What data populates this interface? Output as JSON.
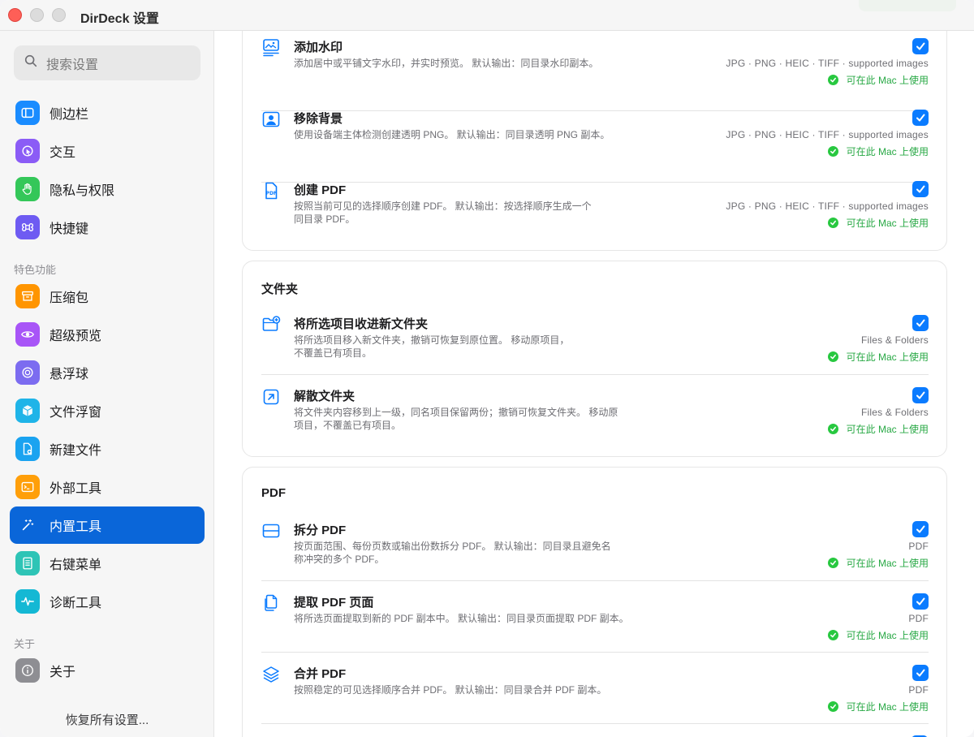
{
  "window": {
    "title": "DirDeck 设置"
  },
  "sidebar": {
    "search_placeholder": "搜索设置",
    "general_items": [
      {
        "label": "侧边栏",
        "icon": "sidebar-icon",
        "color": "#1a8cff"
      },
      {
        "label": "交互",
        "icon": "pointer-icon",
        "color": "#8b5cf6"
      },
      {
        "label": "隐私与权限",
        "icon": "hand-icon",
        "color": "#34c759"
      },
      {
        "label": "快捷键",
        "icon": "command-icon",
        "color": "#6e5bf2"
      }
    ],
    "features_header": "特色功能",
    "feature_items": [
      {
        "label": "压缩包",
        "icon": "archive-icon",
        "color": "#ff9500"
      },
      {
        "label": "超级预览",
        "icon": "eye-icon",
        "color": "#a855f7"
      },
      {
        "label": "悬浮球",
        "icon": "target-icon",
        "color": "#7c6cf0"
      },
      {
        "label": "文件浮窗",
        "icon": "cube-icon",
        "color": "#1fb4e8"
      },
      {
        "label": "新建文件",
        "icon": "new-file-icon",
        "color": "#1aa3f0"
      },
      {
        "label": "外部工具",
        "icon": "terminal-icon",
        "color": "#ff9f0a"
      },
      {
        "label": "内置工具",
        "icon": "magic-wand-icon",
        "color": "#0a66d9"
      },
      {
        "label": "右键菜单",
        "icon": "menu-doc-icon",
        "color": "#2ec4b6"
      },
      {
        "label": "诊断工具",
        "icon": "waveform-icon",
        "color": "#14b8d4"
      }
    ],
    "about_header": "关于",
    "about_items": [
      {
        "label": "关于",
        "icon": "info-icon",
        "color": "#8e8e93"
      }
    ],
    "restore_label": "恢复所有设置..."
  },
  "main": {
    "image_card": {
      "rows": [
        {
          "title": "添加水印",
          "desc": "添加居中或平铺文字水印，并实时预览。 默认输出：同目录水印副本。",
          "formats": "JPG · PNG · HEIC · TIFF · supported images",
          "availability": "可在此 Mac 上使用",
          "icon": "image-text-icon"
        },
        {
          "title": "移除背景",
          "desc": "使用设备端主体检测创建透明 PNG。 默认输出：同目录透明 PNG 副本。",
          "formats": "JPG · PNG · HEIC · TIFF · supported images",
          "availability": "可在此 Mac 上使用",
          "icon": "person-frame-icon"
        },
        {
          "title": "创建 PDF",
          "desc": "按照当前可见的选择顺序创建 PDF。 默认输出：按选择顺序生成一个同目录 PDF。",
          "formats": "JPG · PNG · HEIC · TIFF · supported images",
          "availability": "可在此 Mac 上使用",
          "icon": "pdf-doc-icon"
        }
      ]
    },
    "folder_card": {
      "title": "文件夹",
      "rows": [
        {
          "title": "将所选项目收进新文件夹",
          "desc": "将所选项目移入新文件夹，撤销可恢复到原位置。 移动原项目，不覆盖已有项目。",
          "formats": "Files & Folders",
          "availability": "可在此 Mac 上使用",
          "icon": "folder-plus-icon"
        },
        {
          "title": "解散文件夹",
          "desc": "将文件夹内容移到上一级，同名项目保留两份；撤销可恢复文件夹。 移动原项目，不覆盖已有项目。",
          "formats": "Files & Folders",
          "availability": "可在此 Mac 上使用",
          "icon": "arrow-up-right-square-icon"
        }
      ]
    },
    "pdf_card": {
      "title": "PDF",
      "rows": [
        {
          "title": "拆分 PDF",
          "desc": "按页面范围、每份页数或输出份数拆分 PDF。 默认输出：同目录且避免名称冲突的多个 PDF。",
          "formats": "PDF",
          "availability": "可在此 Mac 上使用",
          "icon": "split-rect-icon"
        },
        {
          "title": "提取 PDF 页面",
          "desc": "将所选页面提取到新的 PDF 副本中。 默认输出：同目录页面提取 PDF 副本。",
          "formats": "PDF",
          "availability": "可在此 Mac 上使用",
          "icon": "doc-copy-icon"
        },
        {
          "title": "合并 PDF",
          "desc": "按照稳定的可见选择顺序合并 PDF。 默认输出：同目录合并 PDF 副本。",
          "formats": "PDF",
          "availability": "可在此 Mac 上使用",
          "icon": "layers-icon"
        }
      ]
    }
  },
  "colors": {
    "accent": "#0a7bff",
    "selection": "#0a66d9",
    "available": "#27a844"
  }
}
